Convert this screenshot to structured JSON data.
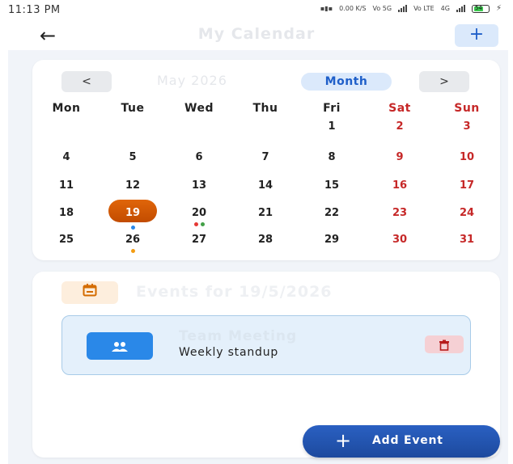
{
  "status_bar": {
    "time": "11:13 PM",
    "net_speed": "0.00 K/S",
    "sim1": "Vo 5G",
    "sim2": "Vo LTE",
    "network_type": "4G",
    "battery_level": "54"
  },
  "app_bar": {
    "back_icon": "arrow-left-icon",
    "title": "My Calendar",
    "add_label": "+"
  },
  "calendar": {
    "prev_label": "<",
    "next_label": ">",
    "month_label": "May 2026",
    "view_mode": "Month",
    "weekdays": [
      "Mon",
      "Tue",
      "Wed",
      "Thu",
      "Fri",
      "Sat",
      "Sun"
    ],
    "weeks": [
      [
        "",
        "",
        "",
        "",
        "1",
        "2",
        "3"
      ],
      [
        "4",
        "5",
        "6",
        "7",
        "8",
        "9",
        "10"
      ],
      [
        "11",
        "12",
        "13",
        "14",
        "15",
        "16",
        "17"
      ],
      [
        "18",
        "19",
        "20",
        "21",
        "22",
        "23",
        "24"
      ],
      [
        "25",
        "26",
        "27",
        "28",
        "29",
        "30",
        "31"
      ]
    ],
    "selected_day": "19",
    "event_dots": {
      "19": [
        "#2a88e8"
      ],
      "20": [
        "#e53935",
        "#43a047"
      ],
      "26": [
        "#f39c12"
      ]
    },
    "colors": {
      "weekend": "#c62828",
      "today": "#d35400",
      "accent": "#1f5fc9"
    }
  },
  "events_panel": {
    "icon": "calendar-icon",
    "title": "Events for 19/5/2026",
    "items": [
      {
        "icon": "group-icon",
        "title": "Team Meeting",
        "description": "Weekly standup",
        "delete_icon": "trash-icon"
      }
    ]
  },
  "fab": {
    "icon": "plus-icon",
    "label": "Add Event"
  }
}
